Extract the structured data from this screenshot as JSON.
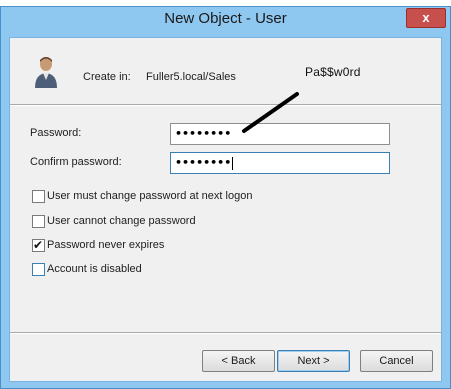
{
  "window": {
    "title": "New Object - User",
    "close_label": "x"
  },
  "header": {
    "create_in_label": "Create in:",
    "path": "Fuller5.local/Sales",
    "annotation": "Pa$$w0rd"
  },
  "fields": {
    "password_label": "Password:",
    "password_value": "••••••••",
    "confirm_label": "Confirm password:",
    "confirm_value": "••••••••"
  },
  "options": [
    {
      "label": "User must change password at next logon",
      "checked": false
    },
    {
      "label": "User cannot change password",
      "checked": false
    },
    {
      "label": "Password never expires",
      "checked": true
    },
    {
      "label": "Account is disabled",
      "checked": false
    }
  ],
  "buttons": {
    "back": "< Back",
    "next": "Next >",
    "cancel": "Cancel"
  },
  "colors": {
    "title_bar": "#8ec7ef",
    "close_button": "#c7504c",
    "dialog_bg": "#f0f0f0",
    "focus_border": "#3c7fb1"
  },
  "icons": {
    "user": "user-icon",
    "check": "checkmark-icon"
  }
}
